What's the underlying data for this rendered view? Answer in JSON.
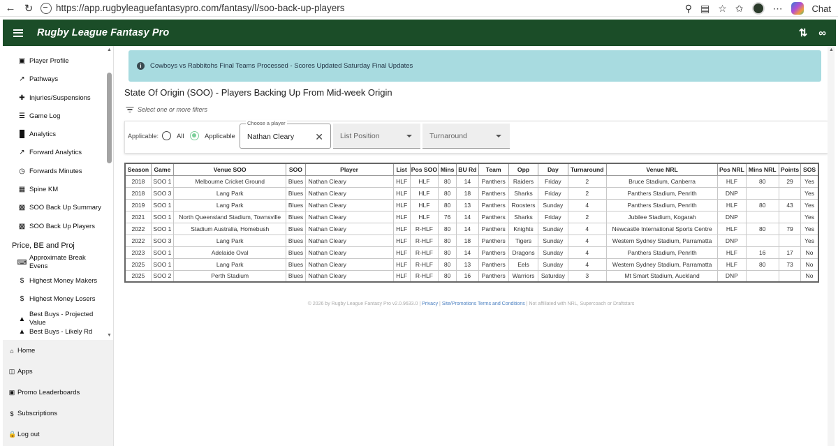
{
  "browser": {
    "url": "https://app.rugbyleaguefantasypro.com/fantasy/l/soo-back-up-players",
    "chat_label": "Chat"
  },
  "app": {
    "title": "Rugby League Fantasy Pro",
    "brand_color": "#1b4d28"
  },
  "sidebar": {
    "items": [
      {
        "label": "Player Profile",
        "icon": "account-box-icon"
      },
      {
        "label": "Pathways",
        "icon": "trending-up-icon"
      },
      {
        "label": "Injuries/Suspensions",
        "icon": "medical-cross-icon"
      },
      {
        "label": "Game Log",
        "icon": "list-icon"
      },
      {
        "label": "Analytics",
        "icon": "bar-chart-icon"
      },
      {
        "label": "Forward Analytics",
        "icon": "trending-up-icon"
      },
      {
        "label": "Forwards Minutes",
        "icon": "timer-icon"
      },
      {
        "label": "Spine KM",
        "icon": "spine-icon"
      },
      {
        "label": "SOO Back Up Summary",
        "icon": "clapperboard-icon"
      },
      {
        "label": "SOO Back Up Players",
        "icon": "clapperboard-icon"
      }
    ],
    "group2_title": "Price, BE and Proj",
    "group2_items": [
      {
        "label": "Approximate Break Evens",
        "icon": "keyboard-icon"
      },
      {
        "label": "Highest Money Makers",
        "icon": "dollar-icon"
      },
      {
        "label": "Highest Money Losers",
        "icon": "money-off-icon"
      },
      {
        "label": "Best Buys - Projected Value",
        "icon": "thumb-up-icon"
      },
      {
        "label": "Best Buys - Likely Rd",
        "icon": "thumb-up-icon"
      }
    ],
    "bottom": [
      {
        "label": "Home",
        "icon": "home-icon"
      },
      {
        "label": "Apps",
        "icon": "apps-icon"
      },
      {
        "label": "Promo Leaderboards",
        "icon": "gift-icon"
      },
      {
        "label": "Subscriptions",
        "icon": "dollar-icon"
      },
      {
        "label": "Log out",
        "icon": "lock-icon"
      }
    ]
  },
  "alert": {
    "text": "Cowboys vs Rabbitohs Final Teams Processed - Scores Updated Saturday Final Updates"
  },
  "page": {
    "title": "State Of Origin (SOO) - Players Backing Up From Mid-week Origin",
    "filters_hint": "Select one or more filters"
  },
  "filters": {
    "applicable_label": "Applicable:",
    "radio_all": "All",
    "radio_applicable": "Applicable",
    "selected_radio": "Applicable",
    "player_label": "Choose a player",
    "player_value": "Nathan Cleary",
    "list_position_placeholder": "List Position",
    "turnaround_placeholder": "Turnaround"
  },
  "table": {
    "columns": [
      "Season",
      "Game",
      "Venue SOO",
      "SOO",
      "Player",
      "List",
      "Pos SOO",
      "Mins",
      "BU Rd",
      "Team",
      "Opp",
      "Day",
      "Turnaround",
      "Venue NRL",
      "Pos NRL",
      "Mins NRL",
      "Points",
      "SOS"
    ],
    "rows": [
      [
        "2018",
        "SOO 1",
        "Melbourne Cricket Ground",
        "Blues",
        "Nathan Cleary",
        "HLF",
        "HLF",
        "80",
        "14",
        "Panthers",
        "Raiders",
        "Friday",
        "2",
        "Bruce Stadium, Canberra",
        "HLF",
        "80",
        "29",
        "Yes"
      ],
      [
        "2018",
        "SOO 3",
        "Lang Park",
        "Blues",
        "Nathan Cleary",
        "HLF",
        "HLF",
        "80",
        "18",
        "Panthers",
        "Sharks",
        "Friday",
        "2",
        "Panthers Stadium, Penrith",
        "DNP",
        "",
        "",
        "Yes"
      ],
      [
        "2019",
        "SOO 1",
        "Lang Park",
        "Blues",
        "Nathan Cleary",
        "HLF",
        "HLF",
        "80",
        "13",
        "Panthers",
        "Roosters",
        "Sunday",
        "4",
        "Panthers Stadium, Penrith",
        "HLF",
        "80",
        "43",
        "Yes"
      ],
      [
        "2021",
        "SOO 1",
        "North Queensland Stadium, Townsville",
        "Blues",
        "Nathan Cleary",
        "HLF",
        "HLF",
        "76",
        "14",
        "Panthers",
        "Sharks",
        "Friday",
        "2",
        "Jubilee Stadium, Kogarah",
        "DNP",
        "",
        "",
        "Yes"
      ],
      [
        "2022",
        "SOO 1",
        "Stadium Australia, Homebush",
        "Blues",
        "Nathan Cleary",
        "HLF",
        "R-HLF",
        "80",
        "14",
        "Panthers",
        "Knights",
        "Sunday",
        "4",
        "Newcastle International Sports Centre",
        "HLF",
        "80",
        "79",
        "Yes"
      ],
      [
        "2022",
        "SOO 3",
        "Lang Park",
        "Blues",
        "Nathan Cleary",
        "HLF",
        "R-HLF",
        "80",
        "18",
        "Panthers",
        "Tigers",
        "Sunday",
        "4",
        "Western Sydney Stadium, Parramatta",
        "DNP",
        "",
        "",
        "Yes"
      ],
      [
        "2023",
        "SOO 1",
        "Adelaide Oval",
        "Blues",
        "Nathan Cleary",
        "HLF",
        "R-HLF",
        "80",
        "14",
        "Panthers",
        "Dragons",
        "Sunday",
        "4",
        "Panthers Stadium, Penrith",
        "HLF",
        "16",
        "17",
        "No"
      ],
      [
        "2025",
        "SOO 1",
        "Lang Park",
        "Blues",
        "Nathan Cleary",
        "HLF",
        "R-HLF",
        "80",
        "13",
        "Panthers",
        "Eels",
        "Sunday",
        "4",
        "Western Sydney Stadium, Parramatta",
        "HLF",
        "80",
        "73",
        "No"
      ],
      [
        "2025",
        "SOO 2",
        "Perth Stadium",
        "Blues",
        "Nathan Cleary",
        "HLF",
        "R-HLF",
        "80",
        "16",
        "Panthers",
        "Warriors",
        "Saturday",
        "3",
        "Mt Smart Stadium, Auckland",
        "DNP",
        "",
        "",
        "No"
      ]
    ]
  },
  "footer": {
    "copyright": "© 2026 by Rugby League Fantasy Pro v2.0.9633.0 |",
    "privacy": "Privacy",
    "sep1": "|",
    "terms": "Site/Promotions Terms and Conditions",
    "disclaimer": "| Not affiliated with NRL, Supercoach or Draftstars"
  }
}
